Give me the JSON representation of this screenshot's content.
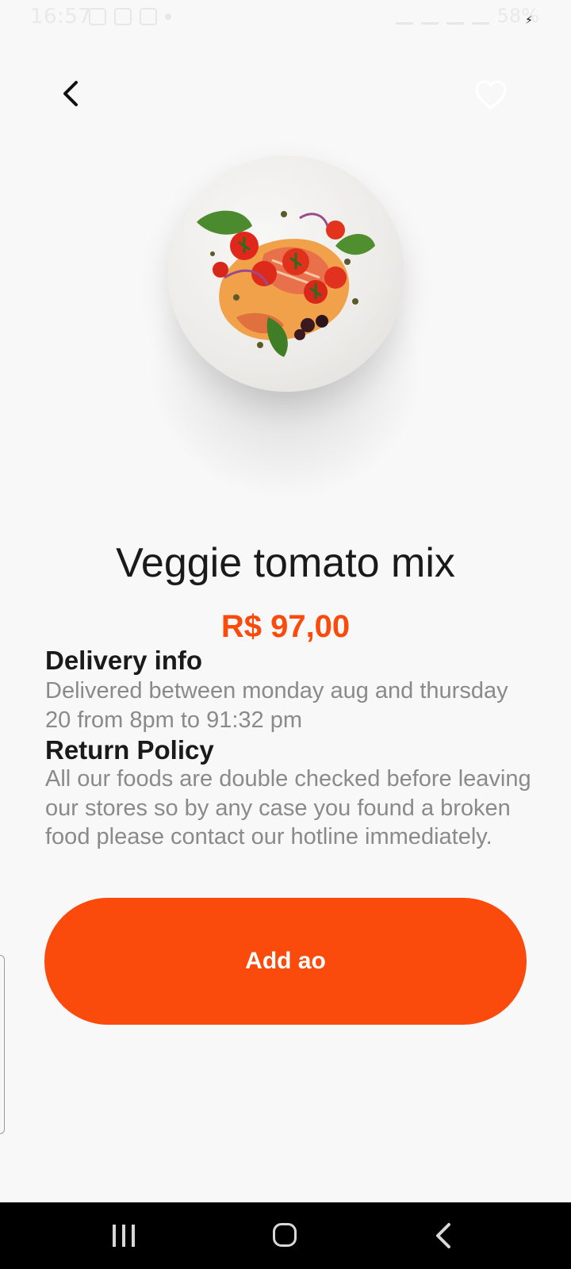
{
  "status_bar": {
    "time": "16:57",
    "battery_percent": "58%"
  },
  "product": {
    "title": "Veggie tomato mix",
    "price": "R$ 97,00"
  },
  "delivery": {
    "heading": "Delivery info",
    "text": "Delivered between monday aug and thursday 20 from 8pm to 91:32 pm"
  },
  "return_policy": {
    "heading": "Return Policy",
    "text": "All our foods are double checked before leaving our stores so by any case you found a broken food please contact our hotline immediately."
  },
  "actions": {
    "add_label": "Add ao"
  },
  "icons": {
    "back": "chevron-left-icon",
    "favorite": "heart-outline-icon",
    "nav_recent": "recent-apps-icon",
    "nav_home": "home-icon",
    "nav_back": "nav-back-icon"
  },
  "colors": {
    "accent": "#FA4A0C",
    "background": "#F8F8F8",
    "title": "#1A1A1A",
    "body_text": "#8A8A8A",
    "nav_bar": "#000000"
  }
}
